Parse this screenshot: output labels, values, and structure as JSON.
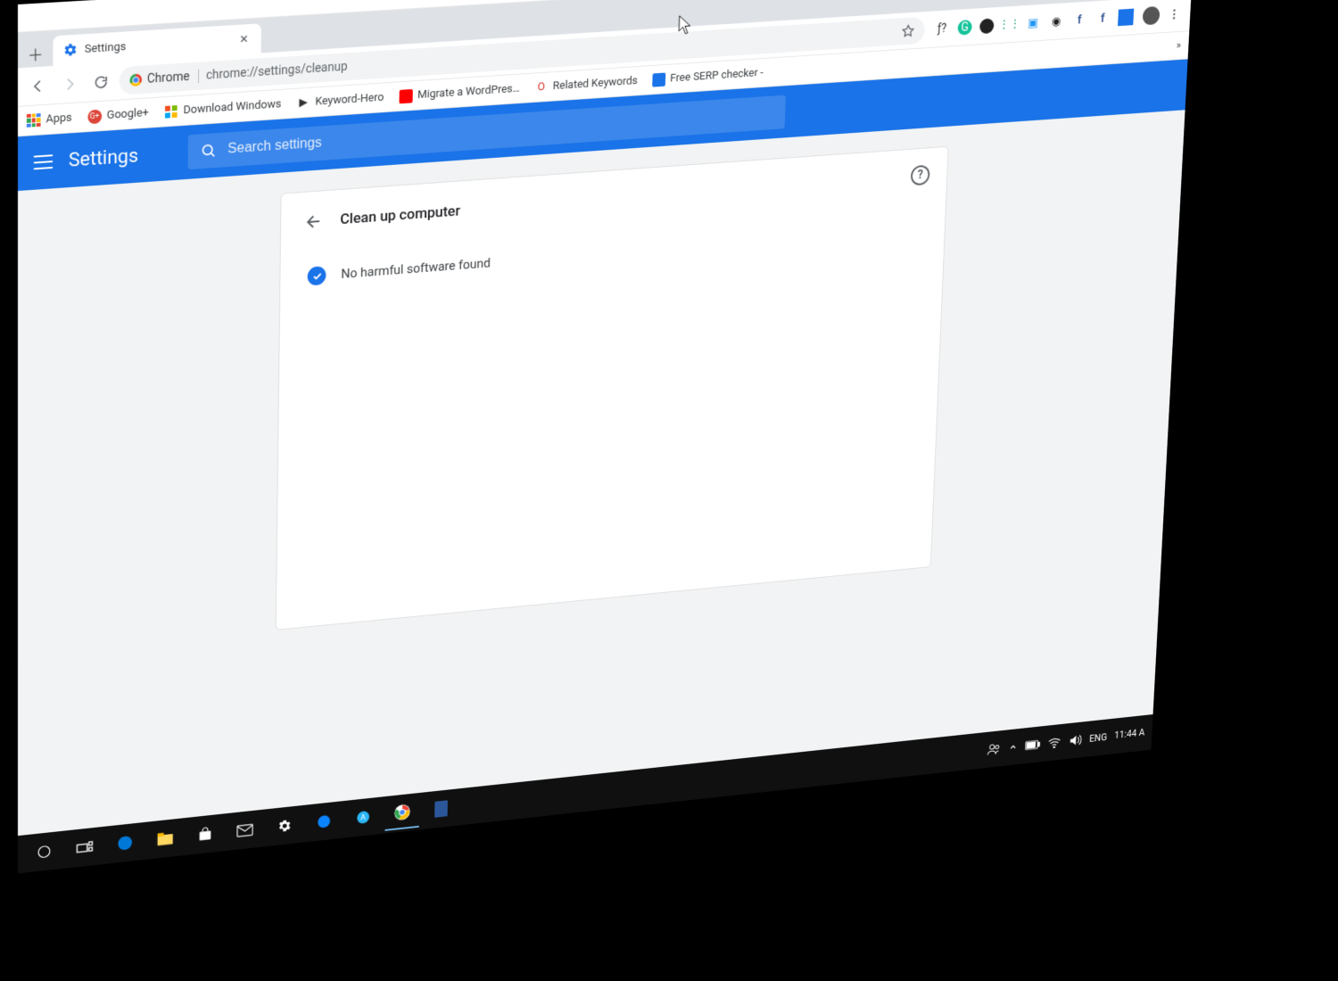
{
  "window_controls": {
    "min": "—",
    "max": "▢",
    "close": "✕"
  },
  "tab": {
    "title": "Settings"
  },
  "toolbar": {
    "chip_label": "Chrome",
    "url": "chrome://settings/cleanup"
  },
  "extensions": [
    {
      "name": "font-question",
      "glyph": "ƒ?",
      "color": "#333"
    },
    {
      "name": "grammarly",
      "glyph": "G",
      "bg": "#15c39a",
      "fg": "#fff",
      "round": true
    },
    {
      "name": "dot-dark",
      "glyph": "",
      "bg": "#222",
      "round": true
    },
    {
      "name": "grid-ext",
      "glyph": "⋮⋮",
      "color": "#2a7"
    },
    {
      "name": "cards-ext",
      "glyph": "▣",
      "color": "#2196f3"
    },
    {
      "name": "camera-ext",
      "glyph": "◉",
      "color": "#222"
    },
    {
      "name": "facebook-1",
      "glyph": "f",
      "color": "#3b5998",
      "bold": true
    },
    {
      "name": "facebook-2",
      "glyph": "f",
      "color": "#3b5998",
      "bold": true
    },
    {
      "name": "blue-square",
      "glyph": "",
      "bg": "#1a73e8"
    }
  ],
  "bookmarks": {
    "apps_label": "Apps",
    "items": [
      {
        "name": "google-plus",
        "label": "Google+",
        "icon_bg": "#db4437",
        "icon_fg": "#fff",
        "glyph": "G+"
      },
      {
        "name": "download-windows",
        "label": "Download Windows",
        "icon": "ms"
      },
      {
        "name": "keyword-hero",
        "label": "Keyword-Hero",
        "glyph": "▶",
        "color": "#333"
      },
      {
        "name": "migrate-wordpress",
        "label": "Migrate a WordPres…",
        "glyph": "▶",
        "color": "#ff0000",
        "bg": "#ff0000"
      },
      {
        "name": "related-keywords",
        "label": "Related Keywords",
        "glyph": "O",
        "color": "#d93025"
      },
      {
        "name": "free-serp-checker",
        "label": "Free SERP checker -",
        "glyph": "",
        "bg": "#1a73e8"
      }
    ],
    "overflow": "»"
  },
  "settings": {
    "app_label": "Settings",
    "search_placeholder": "Search settings",
    "card_title": "Clean up computer",
    "status_text": "No harmful software found",
    "help": "?"
  },
  "taskbar": {
    "lang": "ENG",
    "time": "11:44 A"
  }
}
